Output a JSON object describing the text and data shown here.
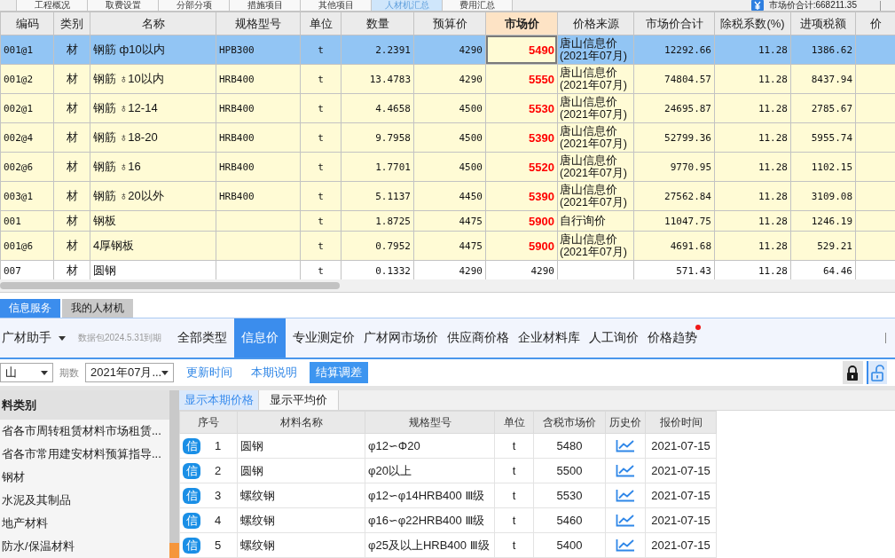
{
  "top_tabs": [
    {
      "label": "工程概况",
      "selected": false
    },
    {
      "label": "取费设置",
      "selected": false
    },
    {
      "label": "分部分项",
      "selected": false
    },
    {
      "label": "措施项目",
      "selected": false
    },
    {
      "label": "其他项目",
      "selected": false
    },
    {
      "label": "人材机汇总",
      "selected": true
    },
    {
      "label": "费用汇总",
      "selected": false
    }
  ],
  "market_total": "市场价合计:668211.35",
  "main_table": {
    "columns": [
      {
        "label": "编码",
        "current": false
      },
      {
        "label": "类别",
        "current": false
      },
      {
        "label": "名称",
        "current": false
      },
      {
        "label": "规格型号",
        "current": false
      },
      {
        "label": "单位",
        "current": false
      },
      {
        "label": "数量",
        "current": false
      },
      {
        "label": "预算价",
        "current": false
      },
      {
        "label": "市场价",
        "current": true
      },
      {
        "label": "价格来源",
        "current": false
      },
      {
        "label": "市场价合计",
        "current": false
      },
      {
        "label": "除税系数(%)",
        "current": false
      },
      {
        "label": "进项税额",
        "current": false
      },
      {
        "label": "价",
        "current": false
      }
    ],
    "rows": [
      {
        "selected": true,
        "adjusted": true,
        "code": "001@1",
        "category": "材",
        "name": "钢筋 ф10以内",
        "spec": "HPB300",
        "unit": "t",
        "quantity": "2.2391",
        "budget_price": "4290",
        "market_price": "5490",
        "price_source": "唐山信息价\n(2021年07月)",
        "market_total": "12292.66",
        "tax_factor": "11.28",
        "input_tax": "1386.62"
      },
      {
        "selected": false,
        "adjusted": true,
        "code": "001@2",
        "category": "材",
        "name": "钢筋 ♁10以内",
        "spec": "HRB400",
        "unit": "t",
        "quantity": "13.4783",
        "budget_price": "4290",
        "market_price": "5550",
        "price_source": "唐山信息价\n(2021年07月)",
        "market_total": "74804.57",
        "tax_factor": "11.28",
        "input_tax": "8437.94"
      },
      {
        "selected": false,
        "adjusted": true,
        "code": "002@1",
        "category": "材",
        "name": "钢筋 ♁12-14",
        "spec": "HRB400",
        "unit": "t",
        "quantity": "4.4658",
        "budget_price": "4500",
        "market_price": "5530",
        "price_source": "唐山信息价\n(2021年07月)",
        "market_total": "24695.87",
        "tax_factor": "11.28",
        "input_tax": "2785.67"
      },
      {
        "selected": false,
        "adjusted": true,
        "code": "002@4",
        "category": "材",
        "name": "钢筋 ♁18-20",
        "spec": "HRB400",
        "unit": "t",
        "quantity": "9.7958",
        "budget_price": "4500",
        "market_price": "5390",
        "price_source": "唐山信息价\n(2021年07月)",
        "market_total": "52799.36",
        "tax_factor": "11.28",
        "input_tax": "5955.74"
      },
      {
        "selected": false,
        "adjusted": true,
        "code": "002@6",
        "category": "材",
        "name": "钢筋 ♁16",
        "spec": "HRB400",
        "unit": "t",
        "quantity": "1.7701",
        "budget_price": "4500",
        "market_price": "5520",
        "price_source": "唐山信息价\n(2021年07月)",
        "market_total": "9770.95",
        "tax_factor": "11.28",
        "input_tax": "1102.15"
      },
      {
        "selected": false,
        "adjusted": true,
        "code": "003@1",
        "category": "材",
        "name": "钢筋 ♁20以外",
        "spec": "HRB400",
        "unit": "t",
        "quantity": "5.1137",
        "budget_price": "4450",
        "market_price": "5390",
        "price_source": "唐山信息价\n(2021年07月)",
        "market_total": "27562.84",
        "tax_factor": "11.28",
        "input_tax": "3109.08"
      },
      {
        "selected": false,
        "adjusted": true,
        "code": "001",
        "category": "材",
        "name": "钢板",
        "unit": "t",
        "quantity": "1.8725",
        "budget_price": "4475",
        "market_price": "5900",
        "price_source": "自行询价",
        "market_total": "11047.75",
        "tax_factor": "11.28",
        "input_tax": "1246.19"
      },
      {
        "selected": false,
        "adjusted": true,
        "code": "001@6",
        "category": "材",
        "name": "4厚钢板",
        "unit": "t",
        "quantity": "0.7952",
        "budget_price": "4475",
        "market_price": "5900",
        "price_source": "唐山信息价\n(2021年07月)",
        "market_total": "4691.68",
        "tax_factor": "11.28",
        "input_tax": "529.21"
      },
      {
        "selected": false,
        "adjusted": false,
        "code": "007",
        "category": "材",
        "name": "圆钢",
        "unit": "t",
        "quantity": "0.1332",
        "budget_price": "4290",
        "market_price": "4290",
        "market_total": "571.43",
        "tax_factor": "11.28",
        "input_tax": "64.46"
      }
    ]
  },
  "service_tabs": [
    {
      "label": "信息服务",
      "selected": true
    },
    {
      "label": "我的人材机",
      "selected": false
    }
  ],
  "toolbar": {
    "assistant": "广材助手",
    "package_note": "数据包2024.5.31到期",
    "price_types": [
      {
        "label": "全部类型",
        "selected": false,
        "notice": false
      },
      {
        "label": "信息价",
        "selected": true,
        "notice": false
      },
      {
        "label": "专业测定价",
        "selected": false,
        "notice": false
      },
      {
        "label": "广材网市场价",
        "selected": false,
        "notice": false
      },
      {
        "label": "供应商价格",
        "selected": false,
        "notice": false
      },
      {
        "label": "企业材料库",
        "selected": false,
        "notice": false
      },
      {
        "label": "人工询价",
        "selected": false,
        "notice": false
      },
      {
        "label": "价格趋势",
        "selected": false,
        "notice": true
      }
    ]
  },
  "filters": {
    "region": "山",
    "period_label": "期数",
    "period": "2021年07月...",
    "actions": [
      {
        "label": "更新时间",
        "primary": false
      },
      {
        "label": "本期说明",
        "primary": false
      },
      {
        "label": "结算调差",
        "primary": true
      }
    ],
    "lock_modes": [
      {
        "kind": "lock",
        "selected": false
      },
      {
        "kind": "unlock",
        "selected": true
      }
    ]
  },
  "category_panel": {
    "title": "料类别",
    "items": [
      "省各市周转租赁材料市场租赁...",
      "省各市常用建安材料预算指导...",
      "钢材",
      "水泥及其制品",
      "地产材料",
      "防水/保温材料"
    ]
  },
  "price_panel": {
    "view_tabs": [
      {
        "label": "显示本期价格",
        "selected": true
      },
      {
        "label": "显示平均价",
        "selected": false
      }
    ],
    "columns": [
      "序号",
      "材料名称",
      "规格型号",
      "单位",
      "含税市场价",
      "历史价",
      "报价时间"
    ],
    "rows": [
      {
        "badge": "信",
        "index": "1",
        "name": "圆钢",
        "spec": "φ12∽Φ20",
        "unit": "t",
        "price": "5480",
        "date": "2021-07-15"
      },
      {
        "badge": "信",
        "index": "2",
        "name": "圆钢",
        "spec": "φ20以上",
        "unit": "t",
        "price": "5500",
        "date": "2021-07-15"
      },
      {
        "badge": "信",
        "index": "3",
        "name": "螺纹钢",
        "spec": "φ12∽φ14HRB400 Ⅲ级",
        "unit": "t",
        "price": "5530",
        "date": "2021-07-15"
      },
      {
        "badge": "信",
        "index": "4",
        "name": "螺纹钢",
        "spec": "φ16∽φ22HRB400 Ⅲ级",
        "unit": "t",
        "price": "5460",
        "date": "2021-07-15"
      },
      {
        "badge": "信",
        "index": "5",
        "name": "螺纹钢",
        "spec": "φ25及以上HRB400 Ⅲ级",
        "unit": "t",
        "price": "5400",
        "date": "2021-07-15"
      }
    ]
  }
}
